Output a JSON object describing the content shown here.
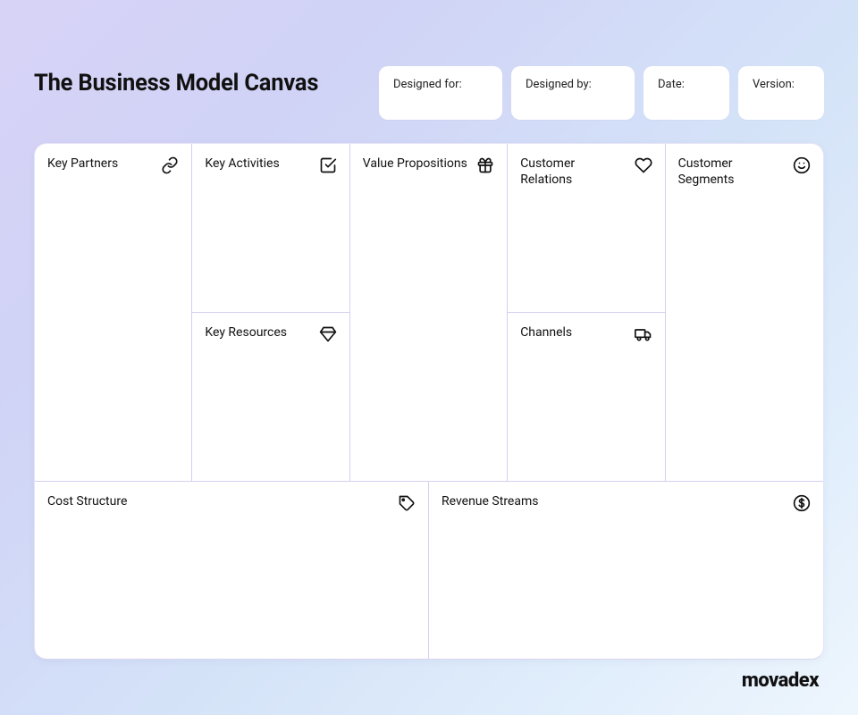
{
  "title": "The Business Model Canvas",
  "meta": {
    "designed_for_label": "Designed for:",
    "designed_by_label": "Designed by:",
    "date_label": "Date:",
    "version_label": "Version:"
  },
  "sections": {
    "key_partners": "Key Partners",
    "key_activities": "Key Activities",
    "key_resources": "Key Resources",
    "value_propositions": "Value Propositions",
    "customer_relations": "Customer Relations",
    "channels": "Channels",
    "customer_segments": "Customer Segments",
    "cost_structure": "Cost Structure",
    "revenue_streams": "Revenue Streams"
  },
  "brand": "movadex"
}
